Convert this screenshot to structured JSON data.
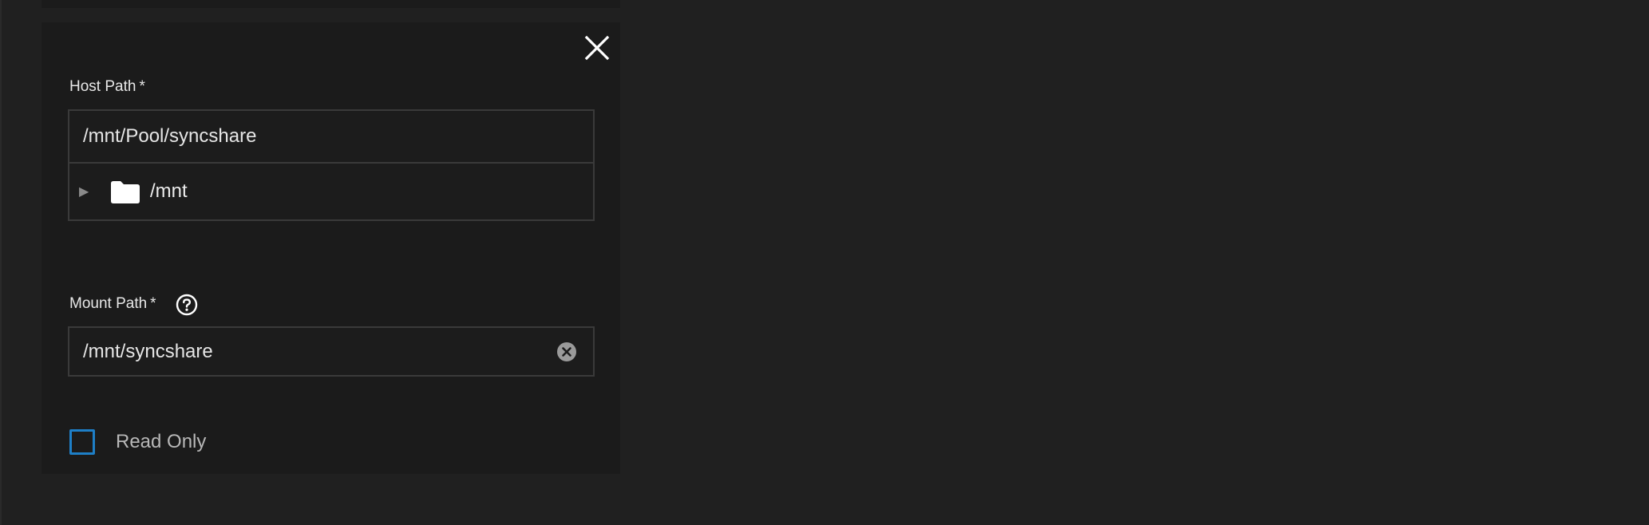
{
  "dialog": {
    "close_icon": "close-icon"
  },
  "host_path": {
    "label": "Host Path",
    "required_mark": "*",
    "value": "/mnt/Pool/syncshare",
    "tree": [
      {
        "label": "/mnt",
        "expand_icon": "triangle-right-icon",
        "icon": "folder-icon"
      }
    ]
  },
  "mount_path": {
    "label": "Mount Path",
    "required_mark": "*",
    "help_icon": "help-circle-icon",
    "value": "/mnt/syncshare",
    "clear_icon": "clear-circle-icon"
  },
  "read_only": {
    "label": "Read Only",
    "checked": false
  },
  "colors": {
    "background": "#202020",
    "card": "#1b1b1b",
    "input_border": "#3a3a3a",
    "checkbox_accent": "#1e7fc7",
    "text": "#e8e8e8"
  }
}
